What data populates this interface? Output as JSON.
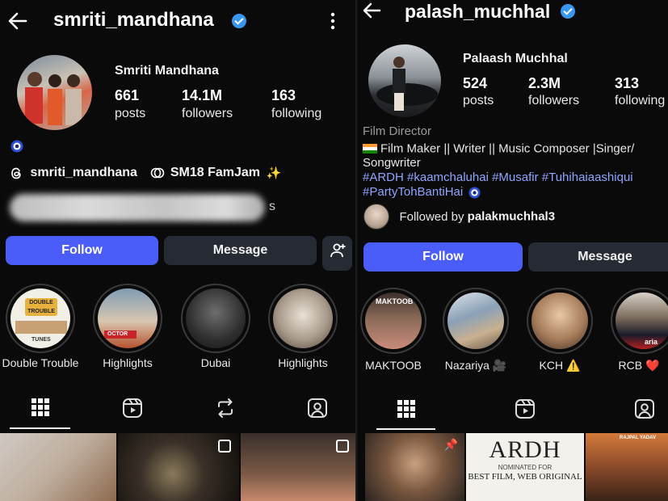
{
  "left": {
    "username": "smriti_mandhana",
    "full_name": "Smriti Mandhana",
    "stats": [
      {
        "num": "661",
        "label": "posts"
      },
      {
        "num": "14.1M",
        "label": "followers"
      },
      {
        "num": "163",
        "label": "following"
      }
    ],
    "threads_handle": "smriti_mandhana",
    "threads_badge": "SM18 FamJam",
    "blurred_tail": "s",
    "follow_label": "Follow",
    "message_label": "Message",
    "highlights": [
      {
        "label": "Double Trouble"
      },
      {
        "label": "Highlights"
      },
      {
        "label": "Dubai"
      },
      {
        "label": "Highlights"
      }
    ],
    "highlight_texts": {
      "double": "DOUBLE",
      "trouble": "TROUBLE",
      "tunes": "TUNES",
      "doctor": "OCTOR"
    }
  },
  "right": {
    "username": "palash_muchhal",
    "full_name": "Palaash Muchhal",
    "stats": [
      {
        "num": "524",
        "label": "posts"
      },
      {
        "num": "2.3M",
        "label": "followers"
      },
      {
        "num": "313",
        "label": "following"
      }
    ],
    "category": "Film Director",
    "bio_line1": "Film Maker || Writer || Music Composer |Singer/",
    "bio_line2": "Songwriter",
    "hashtags_line1": "#ARDH #kaamchaluhai #Musafir #Tuhihaiaashiqui",
    "hashtags_line2": "#PartyTohBantiHai",
    "followed_by_prefix": "Followed by ",
    "followed_by_user": "palakmuchhal3",
    "follow_label": "Follow",
    "message_label": "Message",
    "highlights": [
      {
        "label": "MAKTOOB"
      },
      {
        "label": "Nazariya 🎥"
      },
      {
        "label": "KCH ⚠️"
      },
      {
        "label": "RCB ❤️"
      }
    ],
    "highlight_texts": {
      "maktoob": "MAKTOOB",
      "kch": "aria"
    },
    "post_ardh_title": "ARDH",
    "post_ardh_nominated": "NOMINATED FOR",
    "post_ardh_award": "BEST FILM, WEB ORIGINAL",
    "post_rajpal": "RAJPAL YADAV"
  },
  "colors": {
    "accent": "#4a5df9",
    "verified": "#3897f0",
    "hashtag": "#8fa4ff",
    "background": "#0a0a0a"
  }
}
